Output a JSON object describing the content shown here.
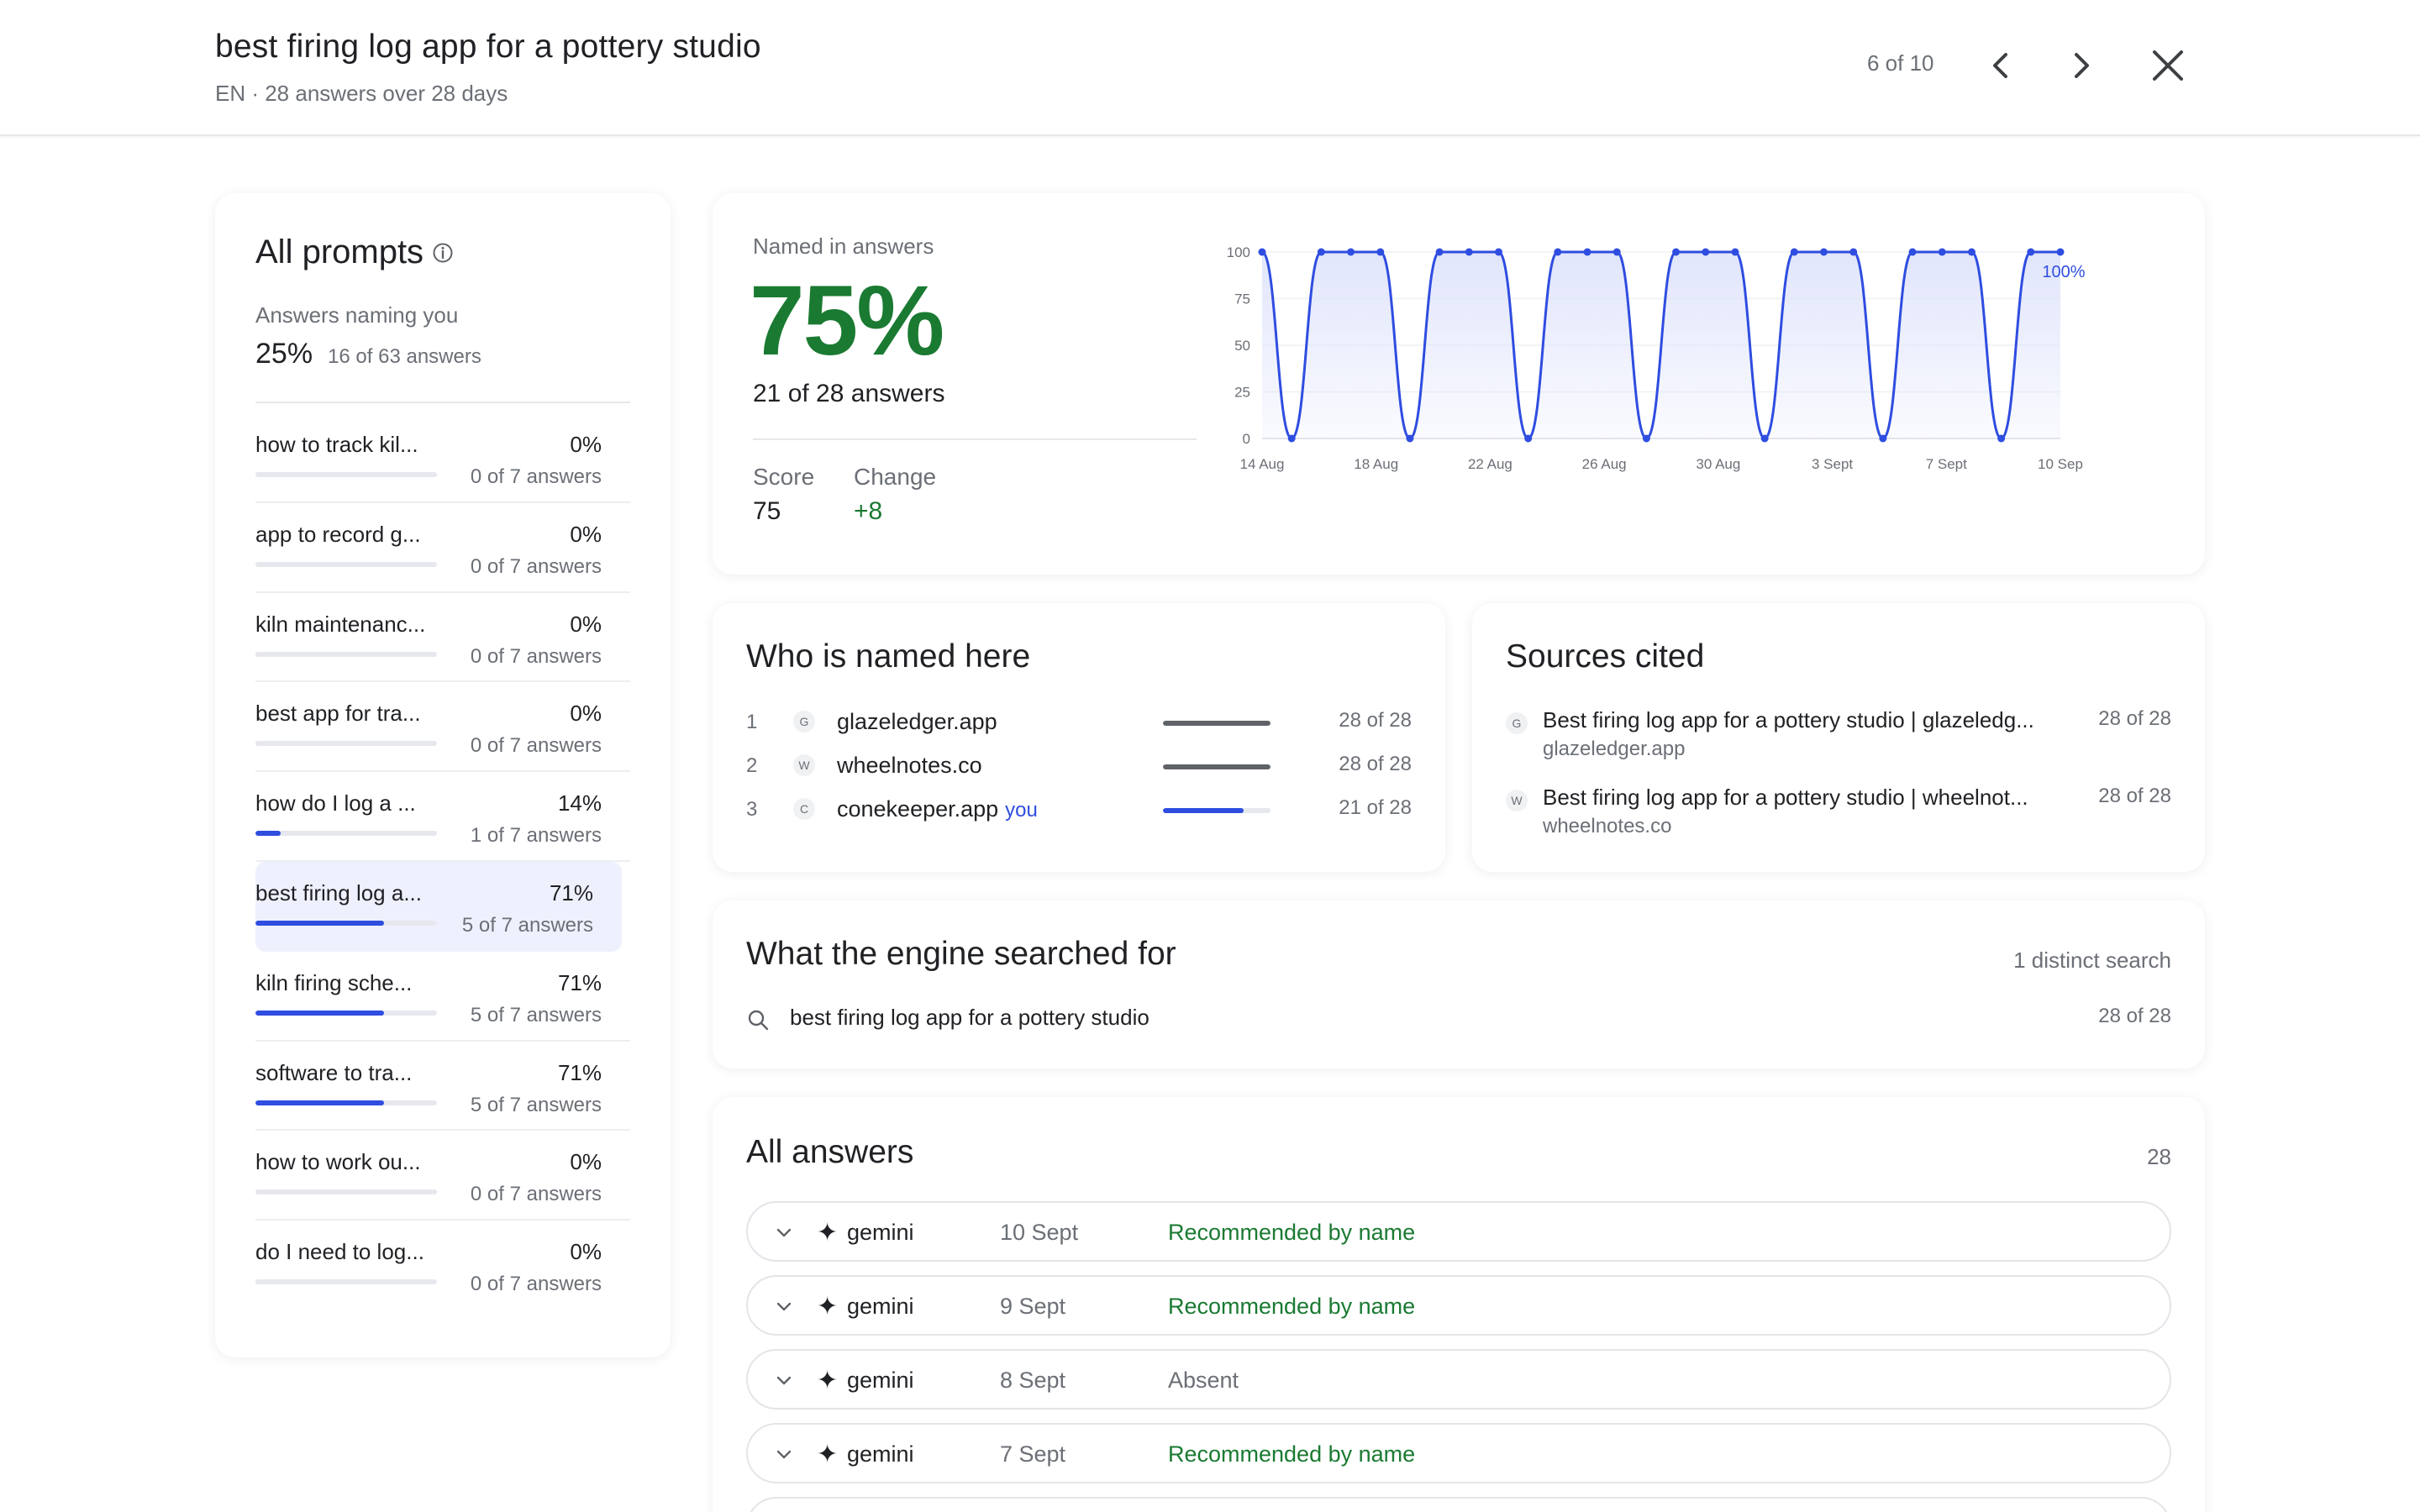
{
  "header": {
    "title": "best firing log app for a pottery studio",
    "subtitle": "EN · 28 answers over 28 days",
    "pager": "6 of 10"
  },
  "sidebar": {
    "title": "All prompts",
    "naming_label": "Answers naming you",
    "naming_pct": "25%",
    "naming_count": "16 of 63 answers",
    "items": [
      {
        "text": "how to track kil...",
        "pct": "0%",
        "count": "0 of 7 answers",
        "fraction": 0,
        "active": false
      },
      {
        "text": "app to record g...",
        "pct": "0%",
        "count": "0 of 7 answers",
        "fraction": 0,
        "active": false
      },
      {
        "text": "kiln maintenanc...",
        "pct": "0%",
        "count": "0 of 7 answers",
        "fraction": 0,
        "active": false
      },
      {
        "text": "best app for tra...",
        "pct": "0%",
        "count": "0 of 7 answers",
        "fraction": 0,
        "active": false
      },
      {
        "text": "how do I log a ...",
        "pct": "14%",
        "count": "1 of 7 answers",
        "fraction": 0.14,
        "active": false
      },
      {
        "text": "best firing log a...",
        "pct": "71%",
        "count": "5 of 7 answers",
        "fraction": 0.71,
        "active": true
      },
      {
        "text": "kiln firing sche...",
        "pct": "71%",
        "count": "5 of 7 answers",
        "fraction": 0.71,
        "active": false
      },
      {
        "text": "software to tra...",
        "pct": "71%",
        "count": "5 of 7 answers",
        "fraction": 0.71,
        "active": false
      },
      {
        "text": "how to work ou...",
        "pct": "0%",
        "count": "0 of 7 answers",
        "fraction": 0,
        "active": false
      },
      {
        "text": "do I need to log...",
        "pct": "0%",
        "count": "0 of 7 answers",
        "fraction": 0,
        "active": false
      }
    ]
  },
  "metric": {
    "label": "Named in answers",
    "value": "75%",
    "answers": "21 of 28 answers",
    "score_label": "Score",
    "score_value": "75",
    "change_label": "Change",
    "change_value": "+8"
  },
  "chart_data": {
    "type": "line",
    "ylim": [
      0,
      100
    ],
    "y_ticks": [
      "100",
      "75",
      "50",
      "25",
      "0"
    ],
    "x_tick_labels": [
      "14 Aug",
      "18 Aug",
      "22 Aug",
      "26 Aug",
      "30 Aug",
      "3 Sept",
      "7 Sept",
      "10 Sep"
    ],
    "end_label": "100%",
    "series": [
      {
        "values": [
          100,
          0,
          100,
          100,
          100,
          0,
          100,
          100,
          100,
          0,
          100,
          100,
          100,
          0,
          100,
          100,
          100,
          0,
          100,
          100,
          100,
          0,
          100,
          100,
          100,
          0,
          100,
          100
        ]
      }
    ],
    "line_color": "#2f4de0",
    "fill_color": "#dfe4fb"
  },
  "who": {
    "title": "Who is named here",
    "items": [
      {
        "rank": "1",
        "initial": "G",
        "name": "glazeledger.app",
        "you": "",
        "count": "28 of 28",
        "fraction": 1,
        "color": "#5f6368"
      },
      {
        "rank": "2",
        "initial": "W",
        "name": "wheelnotes.co",
        "you": "",
        "count": "28 of 28",
        "fraction": 1,
        "color": "#5f6368"
      },
      {
        "rank": "3",
        "initial": "C",
        "name": "conekeeper.app",
        "you": "you",
        "count": "21 of 28",
        "fraction": 0.75,
        "color": "#2f4de0"
      }
    ]
  },
  "sources": {
    "title": "Sources cited",
    "items": [
      {
        "initial": "G",
        "title": "Best firing log app for a pottery studio | glazeledg...",
        "domain": "glazeledger.app",
        "count": "28 of 28"
      },
      {
        "initial": "W",
        "title": "Best firing log app for a pottery studio | wheelnot...",
        "domain": "wheelnotes.co",
        "count": "28 of 28"
      }
    ]
  },
  "search": {
    "title": "What the engine searched for",
    "distinct": "1 distinct search",
    "query": "best firing log app for a pottery studio",
    "count": "28 of 28"
  },
  "answers": {
    "title": "All answers",
    "total": "28",
    "rows": [
      {
        "engine": "gemini",
        "date": "10 Sept",
        "status": "Recommended by name",
        "recommended": true
      },
      {
        "engine": "gemini",
        "date": "9 Sept",
        "status": "Recommended by name",
        "recommended": true
      },
      {
        "engine": "gemini",
        "date": "8 Sept",
        "status": "Absent",
        "recommended": false
      },
      {
        "engine": "gemini",
        "date": "7 Sept",
        "status": "Recommended by name",
        "recommended": true
      },
      {
        "engine": "",
        "date": "",
        "status": "",
        "recommended": false
      }
    ]
  },
  "icons": {
    "info": "info-circle-icon",
    "prev": "chevron-left-icon",
    "next": "chevron-right-icon",
    "close": "close-icon",
    "search": "search-icon",
    "expand": "chevron-down-icon",
    "engine": "sparkle-icon"
  }
}
